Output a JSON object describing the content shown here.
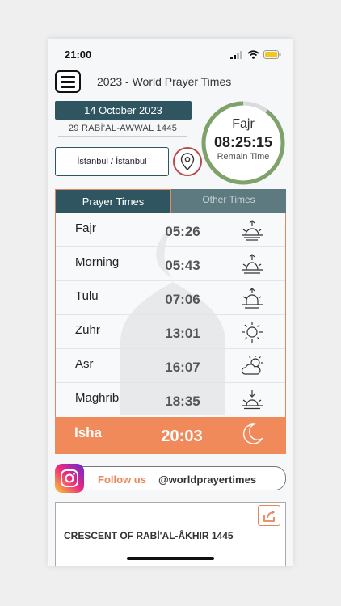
{
  "status_bar": {
    "time": "21:00"
  },
  "header": {
    "title": "2023 - World Prayer Times"
  },
  "date": {
    "gregorian": "14 October 2023",
    "hijri": "29 RABİ'AL-AWWAL 1445"
  },
  "location": {
    "label": "İstanbul / İstanbul"
  },
  "countdown": {
    "prayer": "Fajr",
    "time": "08:25:15",
    "label": "Remain Time",
    "progress": 0.1
  },
  "tabs": [
    {
      "label": "Prayer Times",
      "active": true
    },
    {
      "label": "Other Times",
      "active": false
    }
  ],
  "prayers": [
    {
      "name": "Fajr",
      "time": "05:26",
      "icon": "sunrise-up-icon"
    },
    {
      "name": "Morning",
      "time": "05:43",
      "icon": "sunrise-up-icon"
    },
    {
      "name": "Tulu",
      "time": "07:06",
      "icon": "sunrise-up-icon"
    },
    {
      "name": "Zuhr",
      "time": "13:01",
      "icon": "sun-icon"
    },
    {
      "name": "Asr",
      "time": "16:07",
      "icon": "partly-cloudy-icon"
    },
    {
      "name": "Maghrib",
      "time": "18:35",
      "icon": "sunset-down-icon"
    }
  ],
  "current_prayer": {
    "name": "Isha",
    "time": "20:03",
    "icon": "crescent-moon-icon"
  },
  "social": {
    "label": "Follow us",
    "handle": "@worldprayertimes",
    "icon": "instagram-icon"
  },
  "news": {
    "title": "CRESCENT OF RABİ'AL-ÂKHIR 1445",
    "icon": "share-icon"
  },
  "colors": {
    "primary": "#2f5660",
    "accent": "#f18a5b",
    "ring": "#7ea26a",
    "pin": "#b84848"
  }
}
